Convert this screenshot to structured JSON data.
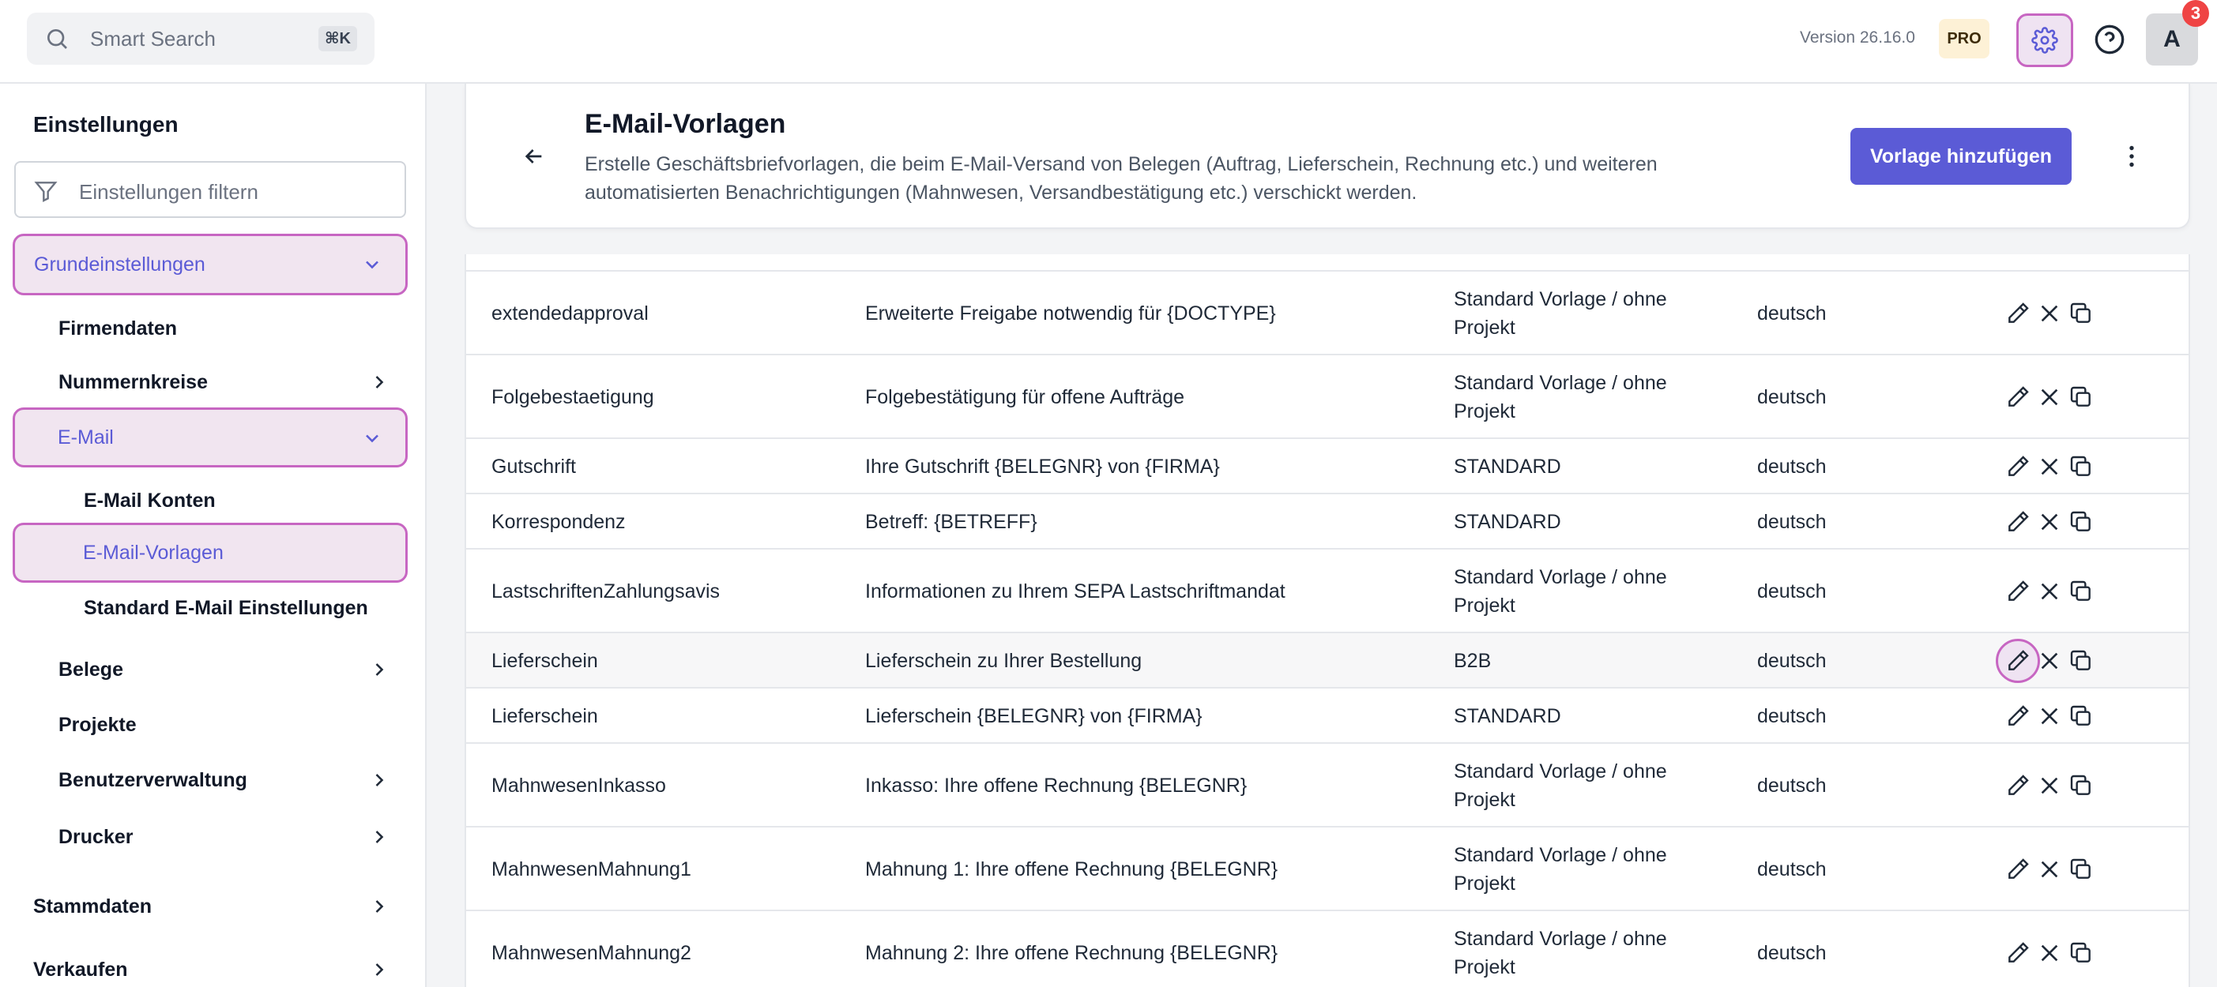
{
  "topbar": {
    "search_placeholder": "Smart Search",
    "search_shortcut": "⌘K",
    "version": "Version 26.16.0",
    "plan_badge": "PRO",
    "avatar_initial": "A",
    "notification_count": "3"
  },
  "sidebar": {
    "title": "Einstellungen",
    "filter_placeholder": "Einstellungen filtern",
    "items": [
      {
        "label": "Grundeinstellungen"
      },
      {
        "label": "Firmendaten"
      },
      {
        "label": "Nummernkreise"
      },
      {
        "label": "E-Mail"
      },
      {
        "label": "E-Mail Konten"
      },
      {
        "label": "E-Mail-Vorlagen"
      },
      {
        "label": "Standard E-Mail Einstellungen"
      },
      {
        "label": "Belege"
      },
      {
        "label": "Projekte"
      },
      {
        "label": "Benutzerverwaltung"
      },
      {
        "label": "Drucker"
      },
      {
        "label": "Stammdaten"
      },
      {
        "label": "Verkaufen"
      }
    ]
  },
  "header": {
    "title": "E-Mail-Vorlagen",
    "description": "Erstelle Geschäftsbriefvorlagen, die beim E-Mail-Versand von Belegen (Auftrag, Lieferschein, Rechnung etc.) und weiteren automatisierten Benachrichtigungen (Mahnwesen, Versandbestätigung etc.) verschickt werden.",
    "add_button": "Vorlage hinzufügen"
  },
  "table": {
    "rows": [
      {
        "name": "extendedapproval",
        "subject": "Erweiterte Freigabe notwendig für {DOCTYPE}",
        "project": "Standard Vorlage / ohne Projekt",
        "language": "deutsch"
      },
      {
        "name": "Folgebestaetigung",
        "subject": "Folgebestätigung für offene Aufträge",
        "project": "Standard Vorlage / ohne Projekt",
        "language": "deutsch"
      },
      {
        "name": "Gutschrift",
        "subject": "Ihre Gutschrift {BELEGNR} von {FIRMA}",
        "project": "STANDARD",
        "language": "deutsch"
      },
      {
        "name": "Korrespondenz",
        "subject": "Betreff: {BETREFF}",
        "project": "STANDARD",
        "language": "deutsch"
      },
      {
        "name": "LastschriftenZahlungsavis",
        "subject": "Informationen zu Ihrem SEPA Lastschriftmandat",
        "project": "Standard Vorlage / ohne Projekt",
        "language": "deutsch"
      },
      {
        "name": "Lieferschein",
        "subject": "Lieferschein zu Ihrer Bestellung",
        "project": "B2B",
        "language": "deutsch"
      },
      {
        "name": "Lieferschein",
        "subject": "Lieferschein {BELEGNR} von {FIRMA}",
        "project": "STANDARD",
        "language": "deutsch"
      },
      {
        "name": "MahnwesenInkasso",
        "subject": "Inkasso: Ihre offene Rechnung {BELEGNR}",
        "project": "Standard Vorlage / ohne Projekt",
        "language": "deutsch"
      },
      {
        "name": "MahnwesenMahnung1",
        "subject": "Mahnung 1: Ihre offene Rechnung {BELEGNR}",
        "project": "Standard Vorlage / ohne Projekt",
        "language": "deutsch"
      },
      {
        "name": "MahnwesenMahnung2",
        "subject": "Mahnung 2: Ihre offene Rechnung {BELEGNR}",
        "project": "Standard Vorlage / ohne Projekt",
        "language": "deutsch"
      }
    ]
  },
  "colors": {
    "accent": "#5b5bd6",
    "focus_ring": "#c766c2",
    "focus_bg": "#efe3f2",
    "pro_bg": "#fdf1d6",
    "notification": "#ef4444"
  }
}
